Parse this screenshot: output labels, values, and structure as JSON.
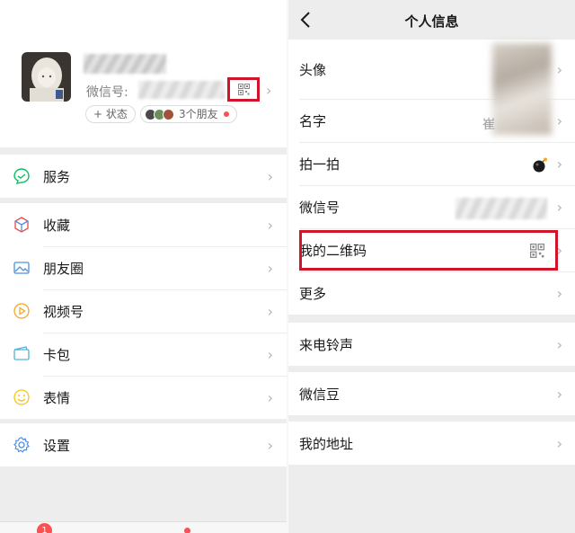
{
  "left": {
    "profile": {
      "wechat_id_label": "微信号:",
      "status_label": "+ 状态",
      "friends_label": "3个朋友"
    },
    "menu_groups": [
      [
        {
          "label": "服务",
          "icon": "service-icon"
        }
      ],
      [
        {
          "label": "收藏",
          "icon": "favorites-icon"
        },
        {
          "label": "朋友圈",
          "icon": "moments-icon"
        },
        {
          "label": "视频号",
          "icon": "channels-icon"
        },
        {
          "label": "卡包",
          "icon": "card-icon"
        },
        {
          "label": "表情",
          "icon": "sticker-icon"
        }
      ],
      [
        {
          "label": "设置",
          "icon": "settings-icon"
        }
      ]
    ],
    "tabbar": {
      "badge_count": "1"
    }
  },
  "right": {
    "title": "个人信息",
    "groups": [
      [
        {
          "label": "头像"
        },
        {
          "label": "名字",
          "value": "崔"
        },
        {
          "label": "拍一拍"
        },
        {
          "label": "微信号"
        },
        {
          "label": "我的二维码"
        },
        {
          "label": "更多"
        }
      ],
      [
        {
          "label": "来电铃声"
        }
      ],
      [
        {
          "label": "微信豆"
        }
      ],
      [
        {
          "label": "我的地址"
        }
      ]
    ]
  },
  "colors": {
    "highlight": "#d0152b",
    "accent": "#07c160",
    "badge": "#fa5151"
  }
}
